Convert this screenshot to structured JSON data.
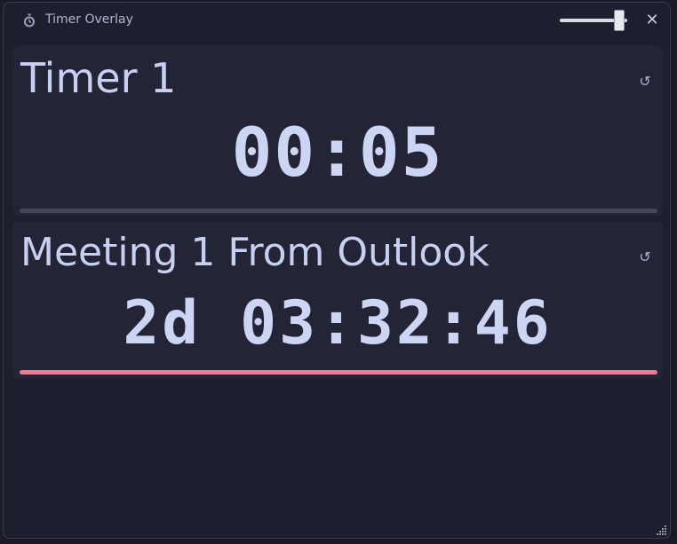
{
  "window": {
    "title": "Timer Overlay",
    "icon": "stopwatch-icon"
  },
  "controls": {
    "opacity_level": 0.9,
    "close_glyph": "✕",
    "reset_glyph": "↺"
  },
  "timers": [
    {
      "name": "Timer 1",
      "value": "00:05",
      "progress_color": "#44465a"
    },
    {
      "name": "Meeting 1 From Outlook",
      "value": "2d 03:32:46",
      "progress_color": "#ee7d96"
    }
  ],
  "colors": {
    "background": "#1e1f2e",
    "card": "#232436",
    "text": "#c9d2f2",
    "accent": "#ee7d96"
  }
}
